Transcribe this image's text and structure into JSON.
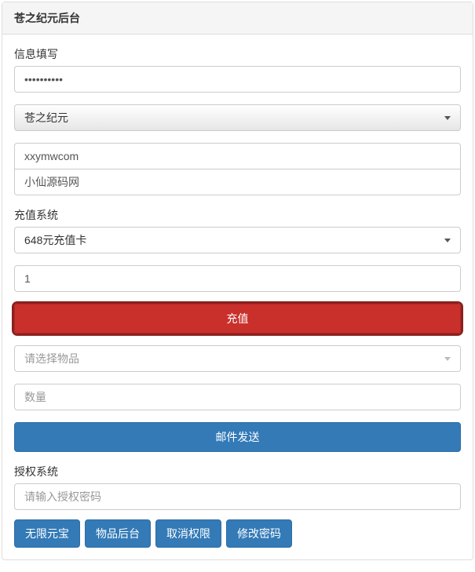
{
  "panel": {
    "title": "苍之纪元后台"
  },
  "info": {
    "label": "信息填写",
    "password_value": "••••••••••",
    "game_select": "苍之纪元",
    "field1": "xxymwcom",
    "field2": "小仙源码网"
  },
  "recharge": {
    "label": "充值系统",
    "card_select": "648元充值卡",
    "amount": "1",
    "submit": "充值",
    "item_placeholder": "请选择物品",
    "qty_placeholder": "数量",
    "mail_btn": "邮件发送"
  },
  "auth": {
    "label": "授权系统",
    "pw_placeholder": "请输入授权密码",
    "btns": {
      "unlimited": "无限元宝",
      "items": "物品后台",
      "revoke": "取消权限",
      "changepw": "修改密码"
    }
  }
}
